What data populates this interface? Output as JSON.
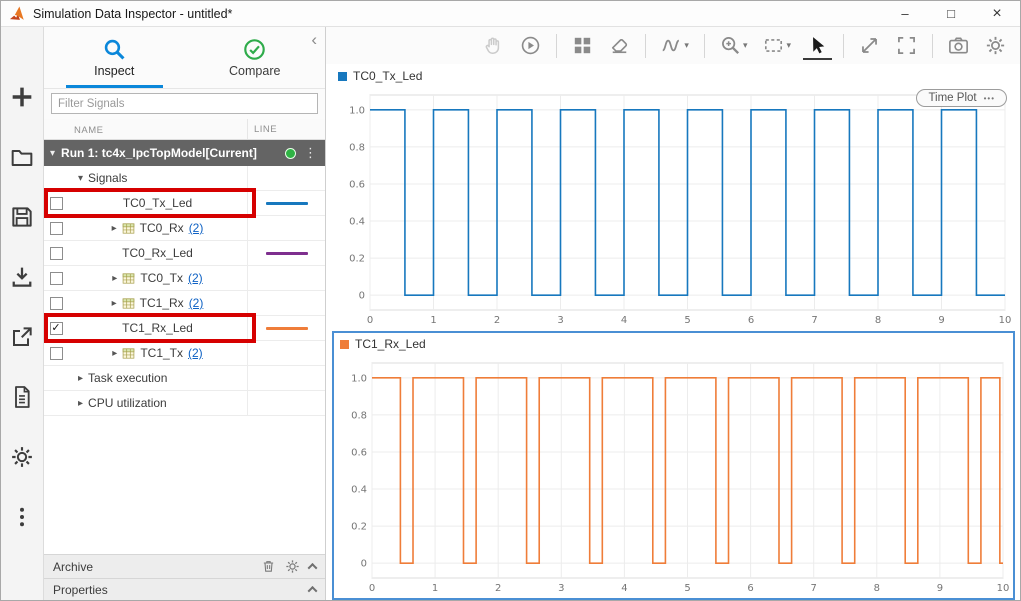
{
  "window": {
    "title": "Simulation Data Inspector - untitled*",
    "controls": {
      "minimize": "–",
      "maximize": "□",
      "close": "×"
    }
  },
  "glyphs": {
    "check": "✓",
    "tri_down": "▾",
    "tri_right": "▸",
    "caret": "▾",
    "dots_vertical": "⋮",
    "menu_dots": "•••",
    "chevron_left": "‹"
  },
  "left_toolbar": {
    "items": [
      {
        "icon": "add-icon"
      },
      {
        "icon": "open-icon"
      },
      {
        "icon": "save-icon"
      },
      {
        "icon": "import-icon"
      },
      {
        "icon": "export-icon"
      },
      {
        "icon": "create-report-icon"
      },
      {
        "icon": "preferences-icon"
      },
      {
        "icon": "more-options-icon"
      }
    ]
  },
  "sidebar": {
    "tabs": [
      {
        "label": "Inspect",
        "active": true
      },
      {
        "label": "Compare",
        "active": false
      }
    ],
    "filter": {
      "placeholder": "Filter Signals"
    },
    "columns": [
      "NAME",
      "LINE"
    ],
    "run": {
      "label": "Run 1: tc4x_IpcTopModel[Current]"
    },
    "rows": [
      {
        "kind": "group",
        "expander": "▾",
        "label": "Signals"
      },
      {
        "kind": "signal",
        "label": "TC0_Tx_Led",
        "checked": false,
        "line_color": "#1778be",
        "highlight": true
      },
      {
        "kind": "channel",
        "expander": "▸",
        "label": "TC0_Rx",
        "count": "(2)"
      },
      {
        "kind": "signal",
        "label": "TC0_Rx_Led",
        "checked": false,
        "line_color": "#7e2f8e"
      },
      {
        "kind": "channel",
        "expander": "▸",
        "label": "TC0_Tx",
        "count": "(2)"
      },
      {
        "kind": "channel",
        "expander": "▸",
        "label": "TC1_Rx",
        "count": "(2)"
      },
      {
        "kind": "signal",
        "label": "TC1_Rx_Led",
        "checked": true,
        "line_color": "#ef7d39",
        "highlight": true
      },
      {
        "kind": "channel",
        "expander": "▸",
        "label": "TC1_Tx",
        "count": "(2)"
      },
      {
        "kind": "group",
        "expander": "▸",
        "label": "Task execution"
      },
      {
        "kind": "group",
        "expander": "▸",
        "label": "CPU utilization"
      }
    ],
    "archive": {
      "label": "Archive"
    },
    "properties": {
      "label": "Properties"
    }
  },
  "plot_toolbar": {
    "items": [
      {
        "icon": "pan-icon",
        "disabled": true
      },
      {
        "icon": "run-playback-icon"
      },
      {
        "sep": true
      },
      {
        "icon": "layout-icon"
      },
      {
        "icon": "clear-plots-icon"
      },
      {
        "sep": true
      },
      {
        "icon": "signal-trace-icon",
        "caret": true
      },
      {
        "sep": true
      },
      {
        "icon": "zoom-icon",
        "caret": true
      },
      {
        "icon": "zoom-region-icon",
        "caret": true
      },
      {
        "icon": "pointer-icon",
        "active": true
      },
      {
        "sep": true
      },
      {
        "icon": "expand-axes-icon"
      },
      {
        "icon": "fit-to-view-icon"
      },
      {
        "sep": true
      },
      {
        "icon": "snapshot-icon"
      },
      {
        "icon": "plot-settings-icon"
      }
    ]
  },
  "chart_data": [
    {
      "type": "line",
      "legend_label": "TC0_Tx_Led",
      "badge": "Time Plot",
      "color": "#1778be",
      "xlim": [
        0,
        10
      ],
      "ylim": [
        0,
        1
      ],
      "grid": true,
      "x_tick_values": [
        0,
        1,
        2,
        3,
        4,
        5,
        6,
        7,
        8,
        9,
        10
      ],
      "x_tick_labels": [
        "0",
        "1",
        "2",
        "3",
        "4",
        "5",
        "6",
        "7",
        "8",
        "9",
        "10"
      ],
      "y_tick_values": [
        0,
        0.2,
        0.4,
        0.6,
        0.8,
        1.0
      ],
      "y_tick_labels": [
        "0",
        "0.2",
        "0.4",
        "0.6",
        "0.8",
        "1.0"
      ],
      "wave": {
        "initial": 1,
        "transitions": [
          0.55,
          1,
          1.55,
          2,
          2.55,
          3,
          3.55,
          4,
          4.55,
          5,
          5.55,
          6,
          6.55,
          7,
          7.55,
          8,
          8.55,
          9,
          9.55
        ],
        "t_end": 10
      }
    },
    {
      "type": "line",
      "legend_label": "TC1_Rx_Led",
      "color": "#ef7d39",
      "xlim": [
        0,
        10
      ],
      "ylim": [
        0,
        1
      ],
      "grid": true,
      "x_tick_values": [
        0,
        1,
        2,
        3,
        4,
        5,
        6,
        7,
        8,
        9,
        10
      ],
      "x_tick_labels": [
        "0",
        "1",
        "2",
        "3",
        "4",
        "5",
        "6",
        "7",
        "8",
        "9",
        "10"
      ],
      "y_tick_values": [
        0,
        0.2,
        0.4,
        0.6,
        0.8,
        1.0
      ],
      "y_tick_labels": [
        "0",
        "0.2",
        "0.4",
        "0.6",
        "0.8",
        "1.0"
      ],
      "wave": {
        "initial": 1,
        "transitions": [
          0.45,
          0.65,
          1.45,
          1.65,
          2.45,
          2.65,
          3.45,
          3.65,
          4.45,
          4.65,
          5.45,
          5.65,
          6.45,
          6.65,
          7.45,
          7.65,
          8.45,
          8.65,
          9.45,
          9.65,
          9.95
        ],
        "t_end": 10
      }
    }
  ],
  "colors": {
    "highlight": "#d60000",
    "selection": "#4a8fd4",
    "status_green": "#2fb344",
    "accent_blue": "#0b87da",
    "compare_green": "#2eab4a"
  }
}
